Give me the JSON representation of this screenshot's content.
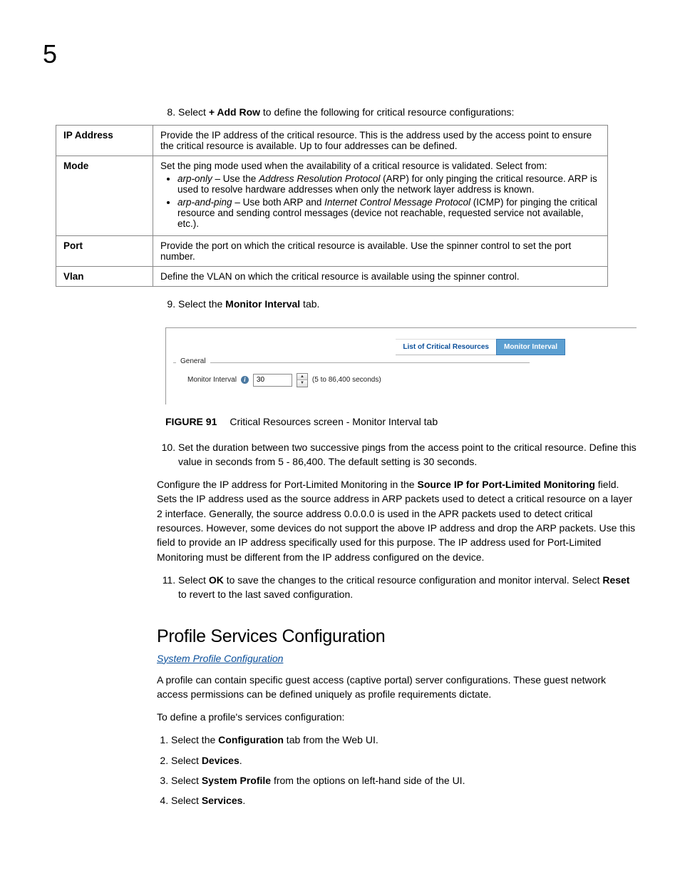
{
  "chapter_number": "5",
  "steps_top": {
    "step8": {
      "prefix": "Select ",
      "bold": "+ Add Row",
      "suffix": " to define the following for critical resource configurations:"
    },
    "step9": {
      "prefix": "Select the ",
      "bold": "Monitor Interval",
      "suffix": " tab."
    },
    "step10": "Set the duration between two successive pings from the access point to the critical resource. Define this value in seconds from 5 - 86,400. The default setting is 30 seconds.",
    "step11_pre": "Select ",
    "step11_ok": "OK",
    "step11_mid": " to save the changes to the critical resource configuration and monitor interval. Select ",
    "step11_reset": "Reset",
    "step11_suf": " to revert to the last saved configuration."
  },
  "table": {
    "rows": [
      {
        "header": "IP Address",
        "body": "Provide the IP address of the critical resource. This is the address used by the access point to ensure the critical resource is available. Up to four addresses can be defined."
      },
      {
        "header": "Mode",
        "intro": "Set the ping mode used when the availability of a critical resource is validated. Select from:",
        "bullets": [
          {
            "em1": "arp-only",
            "mid1": " – Use the ",
            "em2": "Address Resolution Protocol",
            "suf": " (ARP) for only pinging the critical resource. ARP is used to resolve hardware addresses when only the network layer address is known."
          },
          {
            "em1": "arp-and-ping",
            "mid1": " – Use both ARP and ",
            "em2": "Internet Control Message Protocol",
            "suf": " (ICMP) for pinging the critical resource and sending control messages (device not reachable, requested service not available, etc.)."
          }
        ]
      },
      {
        "header": "Port",
        "body": "Provide the port on which the critical resource is available. Use the spinner control to set the port number."
      },
      {
        "header": "Vlan",
        "body": "Define the VLAN on which the critical resource is available using the spinner control."
      }
    ]
  },
  "figure": {
    "tab_inactive": "List of Critical Resources",
    "tab_active": "Monitor Interval",
    "panel_legend": "General",
    "field_label": "Monitor Interval",
    "field_value": "30",
    "field_hint": "(5 to 86,400 seconds)",
    "caption_label": "FIGURE 91",
    "caption_text": "Critical Resources screen - Monitor Interval tab"
  },
  "port_limited": {
    "pre": "Configure the IP address for Port-Limited Monitoring in the ",
    "bold": "Source IP for Port-Limited Monitoring",
    "suf": " field. Sets the IP address used as the source address in ARP packets used to detect a critical resource on a layer 2 interface. Generally, the source address 0.0.0.0 is used in the APR packets used to detect critical resources. However, some devices do not support the above IP address and drop the ARP packets. Use this field to provide an IP address specifically used for this purpose. The IP address used for Port-Limited Monitoring must be different from the IP address configured on the device."
  },
  "section2": {
    "heading": "Profile Services Configuration",
    "link": "System Profile Configuration",
    "para1": "A profile can contain specific guest access (captive portal) server configurations. These guest network access permissions can be defined uniquely as profile requirements dictate.",
    "para2": "To define a profile's services configuration:",
    "steps": {
      "s1_pre": "Select the ",
      "s1_b": "Configuration",
      "s1_suf": " tab from the Web UI.",
      "s2_pre": "Select ",
      "s2_b": "Devices",
      "s2_suf": ".",
      "s3_pre": "Select ",
      "s3_b": "System Profile",
      "s3_suf": " from the options on left-hand side of the UI.",
      "s4_pre": "Select ",
      "s4_b": "Services",
      "s4_suf": "."
    }
  }
}
